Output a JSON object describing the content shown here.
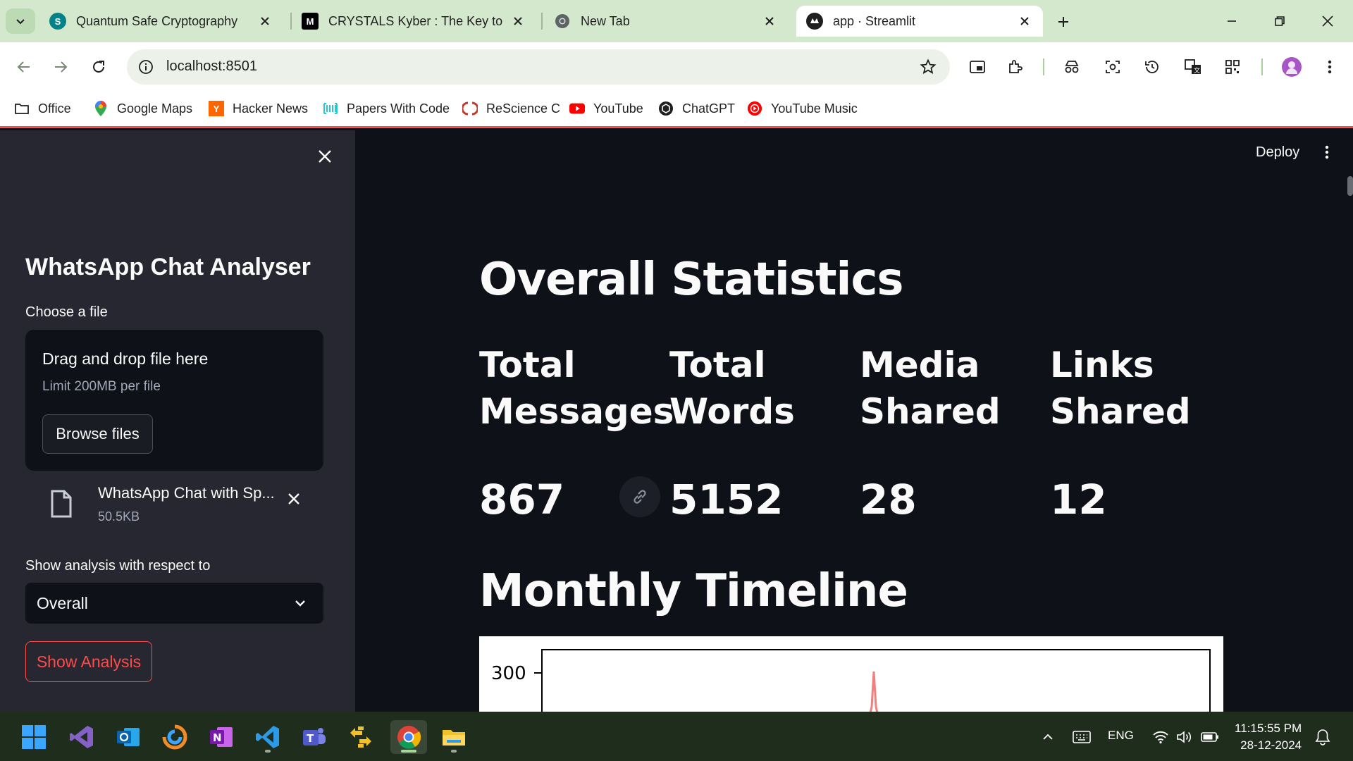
{
  "browser": {
    "tabs": [
      {
        "title": "Quantum Safe Cryptography",
        "favicon": "sharepoint-icon"
      },
      {
        "title": "CRYSTALS Kyber : The Key to Po",
        "favicon": "medium-icon"
      },
      {
        "title": "New Tab",
        "favicon": "chrome-icon"
      },
      {
        "title": "app · Streamlit",
        "favicon": "streamlit-icon",
        "active": true
      }
    ],
    "url": "localhost:8501",
    "bookmarks": [
      {
        "label": "Office",
        "icon": "folder-icon"
      },
      {
        "label": "Google Maps",
        "icon": "google-maps-icon"
      },
      {
        "label": "Hacker News",
        "icon": "hacker-news-icon"
      },
      {
        "label": "Papers With Code",
        "icon": "papers-with-code-icon"
      },
      {
        "label": "ReScience C",
        "icon": "rescience-icon"
      },
      {
        "label": "YouTube",
        "icon": "youtube-icon"
      },
      {
        "label": "ChatGPT",
        "icon": "chatgpt-icon"
      },
      {
        "label": "YouTube Music",
        "icon": "youtube-music-icon"
      }
    ]
  },
  "sidebar": {
    "title": "WhatsApp Chat Analyser",
    "file_label": "Choose a file",
    "dropzone_title": "Drag and drop file here",
    "dropzone_limit": "Limit 200MB per file",
    "browse_label": "Browse files",
    "file_name": "WhatsApp Chat with Sp...",
    "file_size": "50.5KB",
    "analysis_label": "Show analysis with respect to",
    "select_value": "Overall",
    "show_label": "Show Analysis"
  },
  "main": {
    "deploy_label": "Deploy",
    "heading": "Overall Statistics",
    "metrics": [
      {
        "label_line1": "Total",
        "label_line2": "Messages",
        "value": "867"
      },
      {
        "label_line1": "Total",
        "label_line2": "Words",
        "value": "5152"
      },
      {
        "label_line1": "Media",
        "label_line2": "Shared",
        "value": "28"
      },
      {
        "label_line1": "Links",
        "label_line2": "Shared",
        "value": "12"
      }
    ],
    "timeline_heading": "Monthly Timeline",
    "chart": {
      "ytick": "300",
      "line_color": "#f08080"
    }
  },
  "taskbar": {
    "apps": [
      "windows-start-icon",
      "visual-studio-icon",
      "outlook-icon",
      "app-icon",
      "onenote-icon",
      "vscode-icon",
      "teams-icon",
      "file-transfer-icon",
      "chrome-icon",
      "file-explorer-icon"
    ],
    "language": "ENG",
    "time": "11:15:55 PM",
    "date": "28-12-2024"
  },
  "colors": {
    "accent": "#ff4b4b",
    "bg": "#0e1117",
    "sidebar": "#262730",
    "tabstrip": "#d4e8cd"
  }
}
